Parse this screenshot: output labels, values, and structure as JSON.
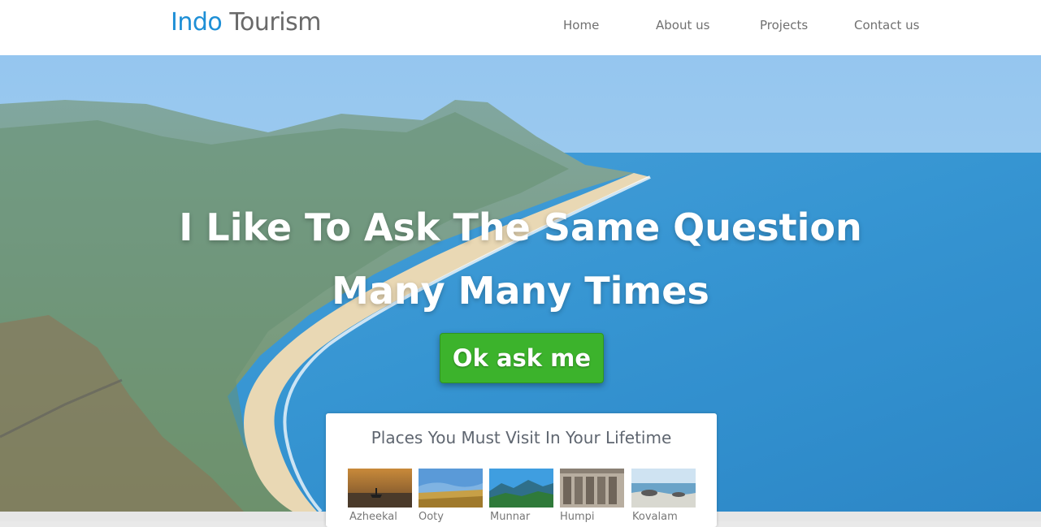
{
  "header": {
    "logo_primary": "Indo",
    "logo_secondary": "Tourism",
    "nav": [
      {
        "label": "Home"
      },
      {
        "label": "About us"
      },
      {
        "label": "Projects"
      },
      {
        "label": "Contact us"
      }
    ]
  },
  "hero": {
    "headline_line1": "I Like To Ask The Same Question",
    "headline_line2": "Many Many Times",
    "cta_label": "Ok ask me"
  },
  "places": {
    "title": "Places You Must Visit In Your Lifetime",
    "items": [
      {
        "label": "Azheekal"
      },
      {
        "label": "Ooty"
      },
      {
        "label": "Munnar"
      },
      {
        "label": "Humpi"
      },
      {
        "label": "Kovalam"
      }
    ]
  },
  "colors": {
    "brand_blue": "#1e8fd6",
    "cta_green": "#3cb32c",
    "sea_blue": "#2a8fd0"
  }
}
